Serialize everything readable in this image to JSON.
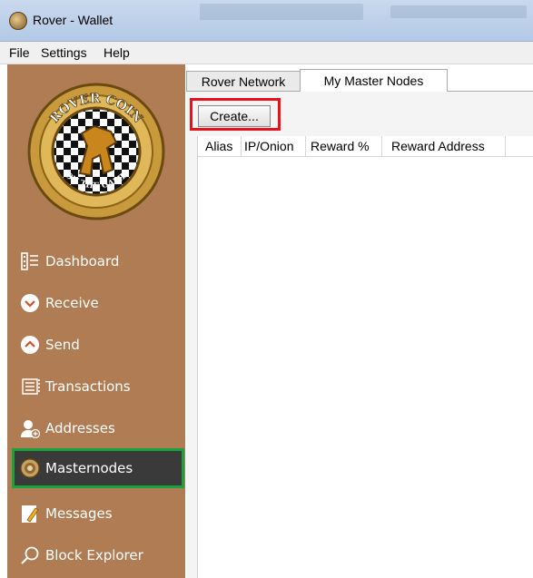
{
  "window": {
    "title": "Rover - Wallet"
  },
  "menu": [
    "File",
    "Settings",
    "Help"
  ],
  "logo": {
    "top_text": "ROVER COIN",
    "bottom_text": "ON THE GAME"
  },
  "sidebar": {
    "items": [
      {
        "label": "Dashboard",
        "icon": "dashboard-icon"
      },
      {
        "label": "Receive",
        "icon": "receive-icon"
      },
      {
        "label": "Send",
        "icon": "send-icon"
      },
      {
        "label": "Transactions",
        "icon": "transactions-icon"
      },
      {
        "label": "Addresses",
        "icon": "addresses-icon"
      },
      {
        "label": "Masternodes",
        "icon": "masternodes-icon",
        "active": true
      },
      {
        "label": "Messages",
        "icon": "messages-icon"
      },
      {
        "label": "Block Explorer",
        "icon": "search-icon"
      }
    ]
  },
  "tabs": [
    {
      "label": "Rover Network",
      "active": false
    },
    {
      "label": "My Master Nodes",
      "active": true
    }
  ],
  "masternodes": {
    "create_label": "Create...",
    "columns": [
      "Alias",
      "IP/Onion",
      "Reward %",
      "Reward Address"
    ]
  },
  "colors": {
    "sidebar_bg": "#b07c54",
    "active_item_bg": "#3a3a3a",
    "highlight_red": "#e8121c",
    "highlight_green": "#18a33c"
  }
}
